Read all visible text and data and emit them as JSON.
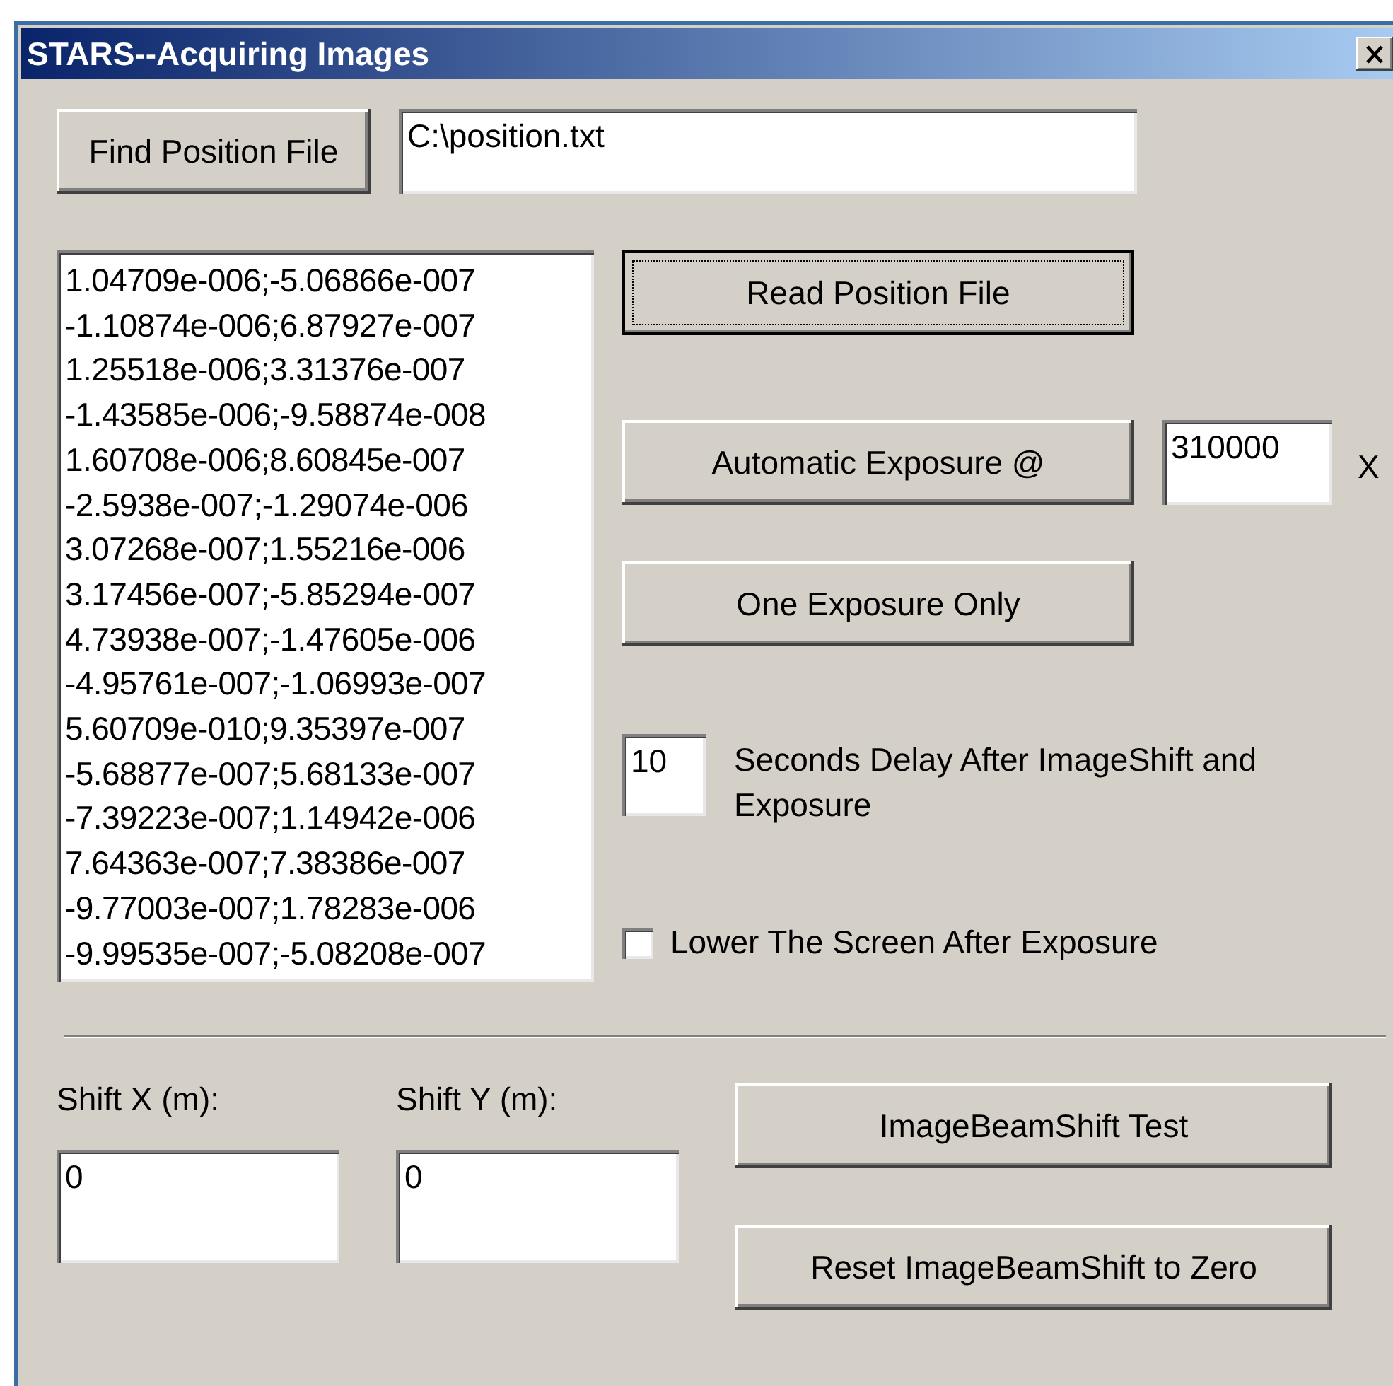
{
  "window": {
    "title": "STARS--Acquiring Images"
  },
  "find_button": {
    "label": "Find Position File"
  },
  "position_file": {
    "value": "C:\\position.txt"
  },
  "positions": [
    "1.04709e-006;-5.06866e-007",
    "-1.10874e-006;6.87927e-007",
    "1.25518e-006;3.31376e-007",
    "-1.43585e-006;-9.58874e-008",
    "1.60708e-006;8.60845e-007",
    "-2.5938e-007;-1.29074e-006",
    "3.07268e-007;1.55216e-006",
    "3.17456e-007;-5.85294e-007",
    "4.73938e-007;-1.47605e-006",
    "-4.95761e-007;-1.06993e-007",
    "5.60709e-010;9.35397e-007",
    "-5.68877e-007;5.68133e-007",
    "-7.39223e-007;1.14942e-006",
    "7.64363e-007;7.38386e-007",
    "-9.77003e-007;1.78283e-006",
    "-9.99535e-007;-5.08208e-007"
  ],
  "read_button": {
    "label": "Read Position File",
    "focused": true
  },
  "auto_exposure": {
    "label": "Automatic Exposure @",
    "value": "310000",
    "unit": "X"
  },
  "one_exposure_button": {
    "label": "One Exposure Only"
  },
  "delay": {
    "value": "10",
    "label": "Seconds Delay After ImageShift and Exposure"
  },
  "lower_screen": {
    "label": "Lower The Screen After Exposure",
    "checked": false
  },
  "shift_x": {
    "label": "Shift X (m):",
    "value": "0"
  },
  "shift_y": {
    "label": "Shift Y (m):",
    "value": "0"
  },
  "test_button": {
    "label": "ImageBeamShift Test"
  },
  "reset_button": {
    "label": "Reset ImageBeamShift to Zero"
  }
}
